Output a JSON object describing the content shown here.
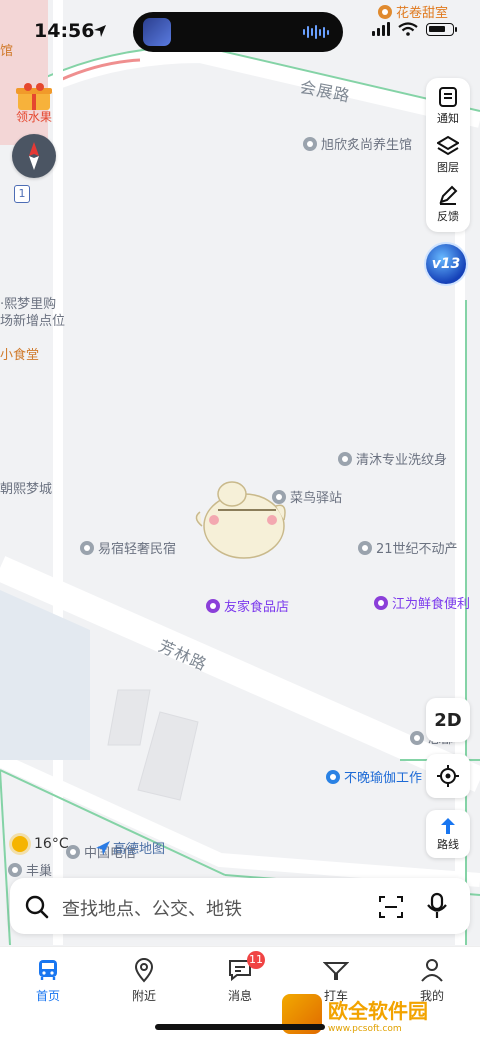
{
  "status_bar": {
    "time": "14:56"
  },
  "map": {
    "roads": [
      "会展路",
      "芳林路"
    ],
    "pois": {
      "top_right": "花卷甜室",
      "top_left_cut": "馆",
      "gift": "领水果",
      "xuxin": "旭欣炙尚养生馆",
      "xmeng1": "·熙梦里购",
      "xmeng2": "场新增点位",
      "xiaoshitang": "小食堂",
      "qingmu": "清沐专业洗纹身",
      "xmengcheng": "朝熙梦城",
      "cainiao": "菜鸟驿站",
      "yisu": "易宿轻奢民宿",
      "c21": "21世纪不动产",
      "youjia": "友家食品店",
      "jiangwei": "江为鲜食便利",
      "buwan": "不晚瑜伽工作",
      "zongbu": "总部",
      "fengchao": "丰巢",
      "zhongguo": "中国电信"
    },
    "compass_index": "1",
    "weather": {
      "temp": "16°C"
    },
    "logo_text": "高德地图"
  },
  "tools": {
    "notify": "通知",
    "layers": "图层",
    "feedback": "反馈",
    "version_badge": "v13"
  },
  "controls": {
    "view_mode": "2D",
    "route": "路线"
  },
  "search": {
    "placeholder": "查找地点、公交、地铁"
  },
  "tabbar": {
    "items": [
      {
        "label": "首页"
      },
      {
        "label": "附近"
      },
      {
        "label": "消息",
        "badge": "11"
      },
      {
        "label": "打车"
      },
      {
        "label": "我的"
      }
    ]
  },
  "watermark": {
    "text": "欧全软件园",
    "url": "www.pcsoft.com"
  },
  "colors": {
    "accent": "#1976f0",
    "badge": "#f04444",
    "map_bg": "#f1f2f4",
    "green_border": "#84d3a6"
  }
}
